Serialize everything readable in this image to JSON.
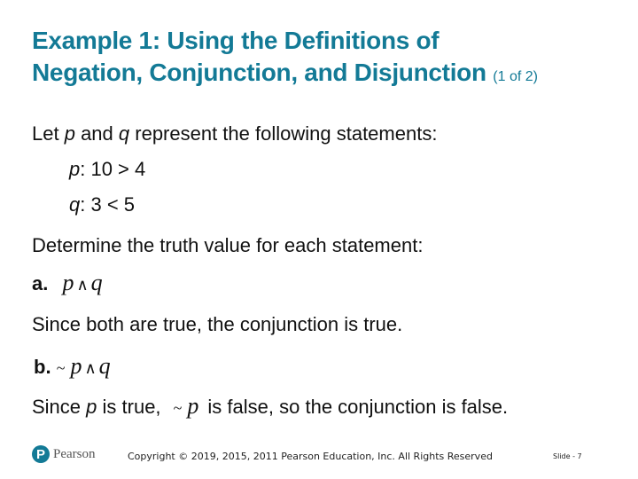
{
  "title": {
    "line1": "Example 1: Using the Definitions of",
    "line2": "Negation, Conjunction, and Disjunction",
    "part": "(1 of 2)"
  },
  "intro": {
    "pre": "Let ",
    "p": "p",
    "mid": " and ",
    "q": "q",
    "post": " represent the following statements:"
  },
  "statements": [
    {
      "var": "p",
      "text": ": 10 > 4"
    },
    {
      "var": "q",
      "text": ": 3 < 5"
    }
  ],
  "instruction": "Determine the truth value for each statement:",
  "part_a": {
    "label": "a.",
    "expr_p": "p",
    "op": "∧",
    "expr_q": "q",
    "explanation": "Since both are true, the conjunction is true."
  },
  "part_b": {
    "label": "b.",
    "tilde": "~",
    "expr_p": "p",
    "op": "∧",
    "expr_q": "q",
    "expl_pre": "Since ",
    "expl_p": "p",
    "expl_mid": " is true,",
    "expl_tilde": "~",
    "expl_p2": "p",
    "expl_post": "is false, so the conjunction is false."
  },
  "footer": {
    "logo_letter": "P",
    "logo_text": "Pearson",
    "copyright": "Copyright © 2019, 2015, 2011 Pearson Education, Inc. All Rights Reserved",
    "slide": "Slide - 7"
  }
}
